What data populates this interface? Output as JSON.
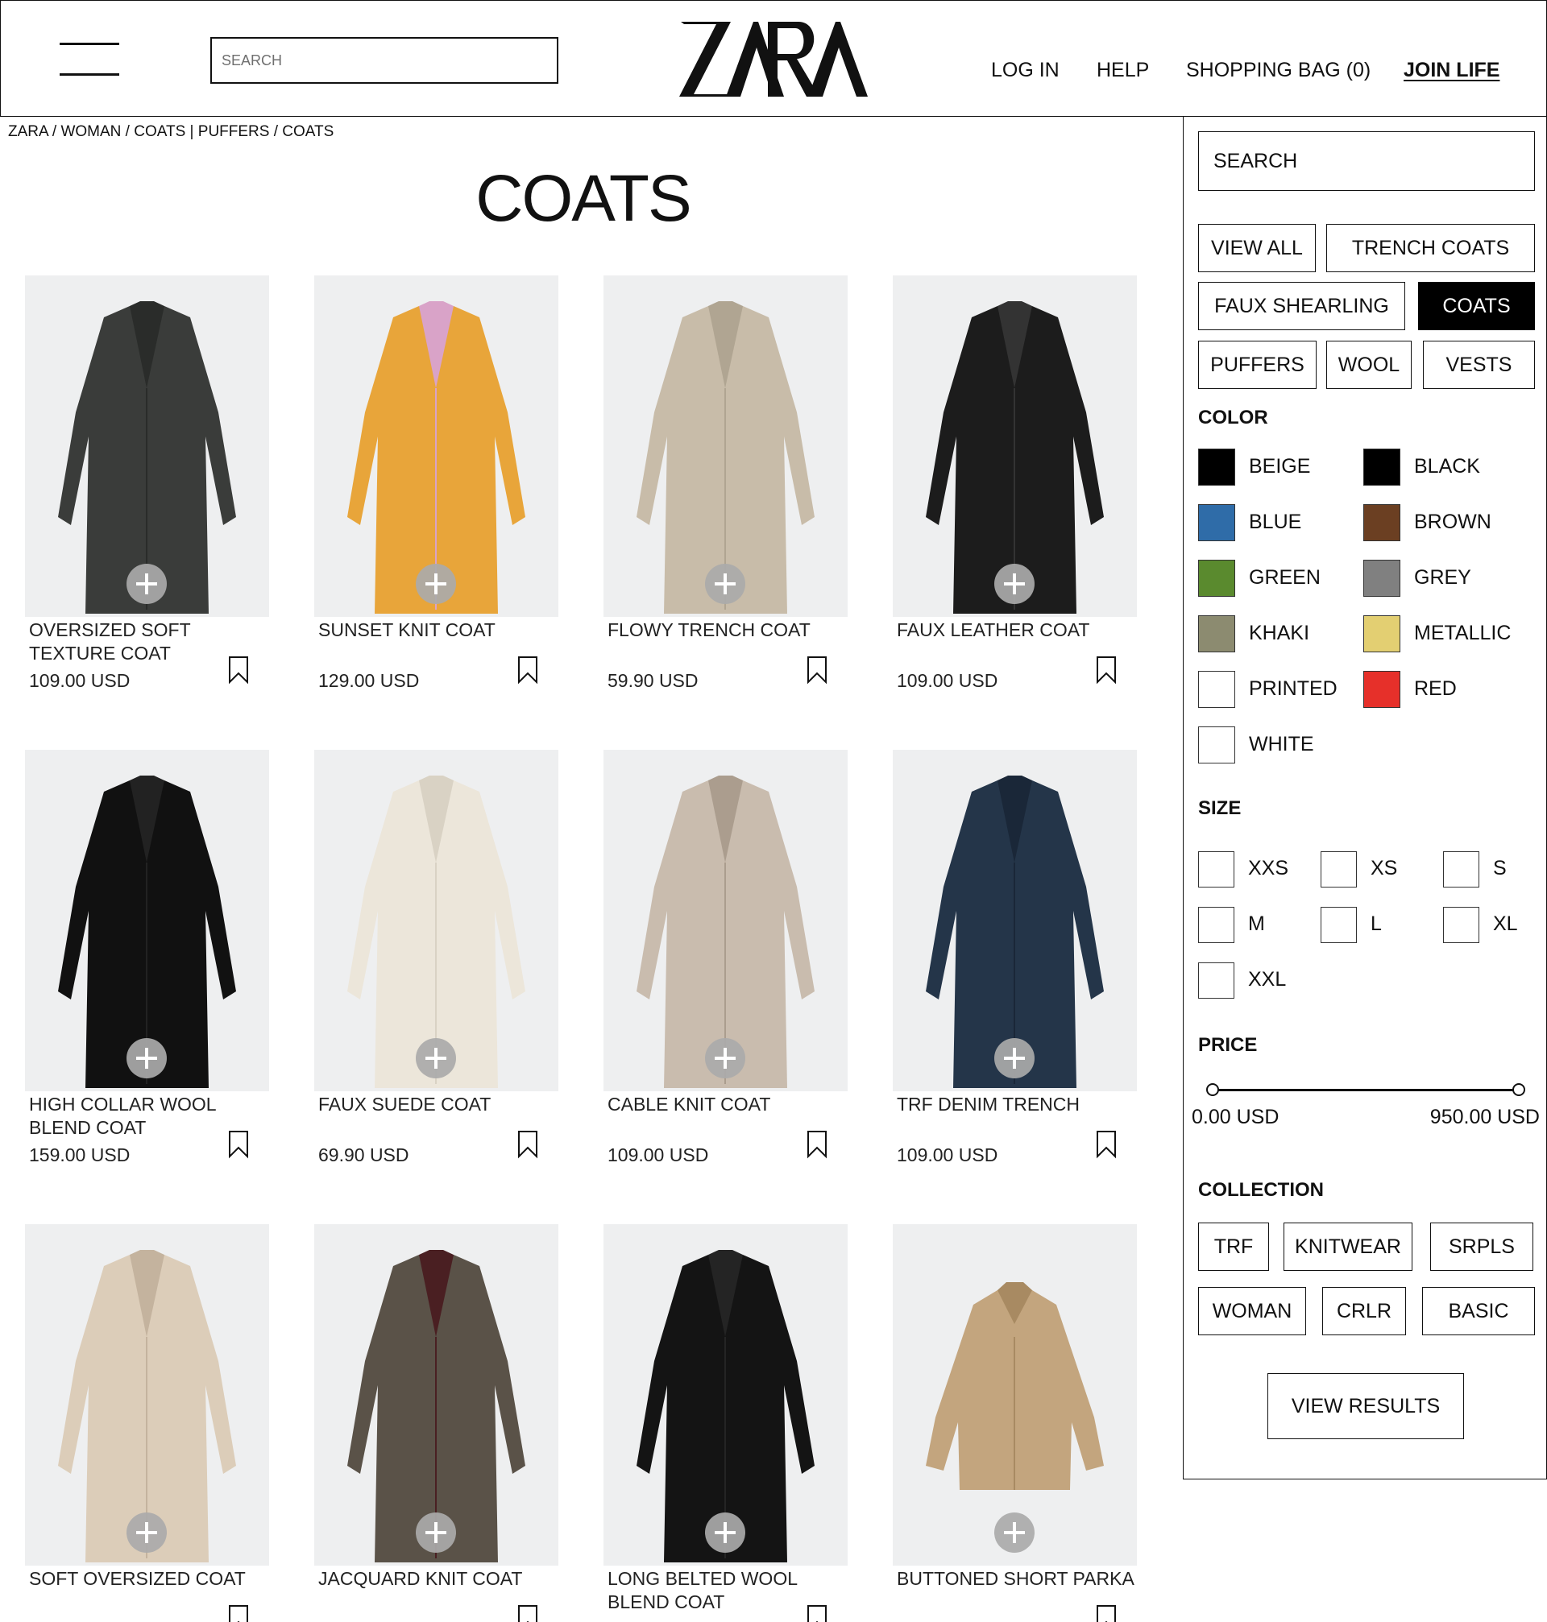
{
  "header": {
    "search_placeholder": "SEARCH",
    "logo": "ZARA",
    "nav": {
      "login": "LOG IN",
      "help": "HELP",
      "bag": "SHOPPING BAG (0)",
      "join_life": "JOIN LIFE"
    }
  },
  "breadcrumb": "ZARA / WOMAN / COATS | PUFFERS / COATS",
  "page_title": "COATS",
  "products": [
    {
      "name": "OVERSIZED SOFT TEXTURE COAT",
      "price": "109.00 USD",
      "colors": {
        "body": "#3a3c3a",
        "accent": "#2a2c2a"
      }
    },
    {
      "name": "SUNSET KNIT COAT",
      "price": "129.00 USD",
      "colors": {
        "body": "#e8a53a",
        "accent": "#d9a3c8"
      }
    },
    {
      "name": "FLOWY TRENCH COAT",
      "price": "59.90 USD",
      "colors": {
        "body": "#c8bca9",
        "accent": "#b0a592"
      }
    },
    {
      "name": "FAUX LEATHER COAT",
      "price": "109.00 USD",
      "colors": {
        "body": "#1c1c1c",
        "accent": "#333333"
      }
    },
    {
      "name": "HIGH COLLAR WOOL BLEND COAT",
      "price": "159.00 USD",
      "colors": {
        "body": "#111111",
        "accent": "#222222"
      }
    },
    {
      "name": "FAUX SUEDE COAT",
      "price": "69.90 USD",
      "colors": {
        "body": "#ece6da",
        "accent": "#d9d2c4"
      }
    },
    {
      "name": "CABLE KNIT COAT",
      "price": "109.00 USD",
      "colors": {
        "body": "#c9bcae",
        "accent": "#ab9d8e"
      }
    },
    {
      "name": "TRF DENIM TRENCH",
      "price": "109.00 USD",
      "colors": {
        "body": "#243549",
        "accent": "#1a2738"
      }
    },
    {
      "name": "SOFT OVERSIZED COAT",
      "price": "",
      "colors": {
        "body": "#dccdb9",
        "accent": "#c4b39e"
      }
    },
    {
      "name": "JACQUARD KNIT COAT",
      "price": "",
      "colors": {
        "body": "#5a5248",
        "accent": "#4a1f22"
      }
    },
    {
      "name": "LONG BELTED WOOL BLEND COAT",
      "price": "",
      "colors": {
        "body": "#141414",
        "accent": "#242424"
      }
    },
    {
      "name": "BUTTONED SHORT PARKA",
      "price": "",
      "colors": {
        "body": "#c3a57e",
        "accent": "#a88a62"
      }
    }
  ],
  "filters": {
    "search_placeholder": "SEARCH",
    "categories": [
      {
        "label": "VIEW ALL",
        "active": false
      },
      {
        "label": "TRENCH COATS",
        "active": false
      },
      {
        "label": "FAUX SHEARLING",
        "active": false
      },
      {
        "label": "COATS",
        "active": true
      },
      {
        "label": "PUFFERS",
        "active": false
      },
      {
        "label": "WOOL",
        "active": false
      },
      {
        "label": "VESTS",
        "active": false
      }
    ],
    "color_heading": "COLOR",
    "colors": [
      {
        "label": "BEIGE",
        "swatch": "#000000"
      },
      {
        "label": "BLACK",
        "swatch": "#000000"
      },
      {
        "label": "BLUE",
        "swatch": "#2f6ca8"
      },
      {
        "label": "BROWN",
        "swatch": "#6b3f22"
      },
      {
        "label": "GREEN",
        "swatch": "#5a8a2e"
      },
      {
        "label": "GREY",
        "swatch": "#808080"
      },
      {
        "label": "KHAKI",
        "swatch": "#8c8b70"
      },
      {
        "label": "METALLIC",
        "swatch": "#e3cf72"
      },
      {
        "label": "PRINTED",
        "swatch": "#ffffff"
      },
      {
        "label": "RED",
        "swatch": "#e6302a"
      },
      {
        "label": "WHITE",
        "swatch": "#ffffff"
      }
    ],
    "size_heading": "SIZE",
    "sizes": [
      "XXS",
      "XS",
      "S",
      "M",
      "L",
      "XL",
      "XXL"
    ],
    "price_heading": "PRICE",
    "price_min": "0.00 USD",
    "price_max": "950.00 USD",
    "collection_heading": "COLLECTION",
    "collections": [
      "TRF",
      "KNITWEAR",
      "SRPLS",
      "WOMAN",
      "CRLR",
      "BASIC"
    ],
    "view_results": "VIEW RESULTS"
  }
}
